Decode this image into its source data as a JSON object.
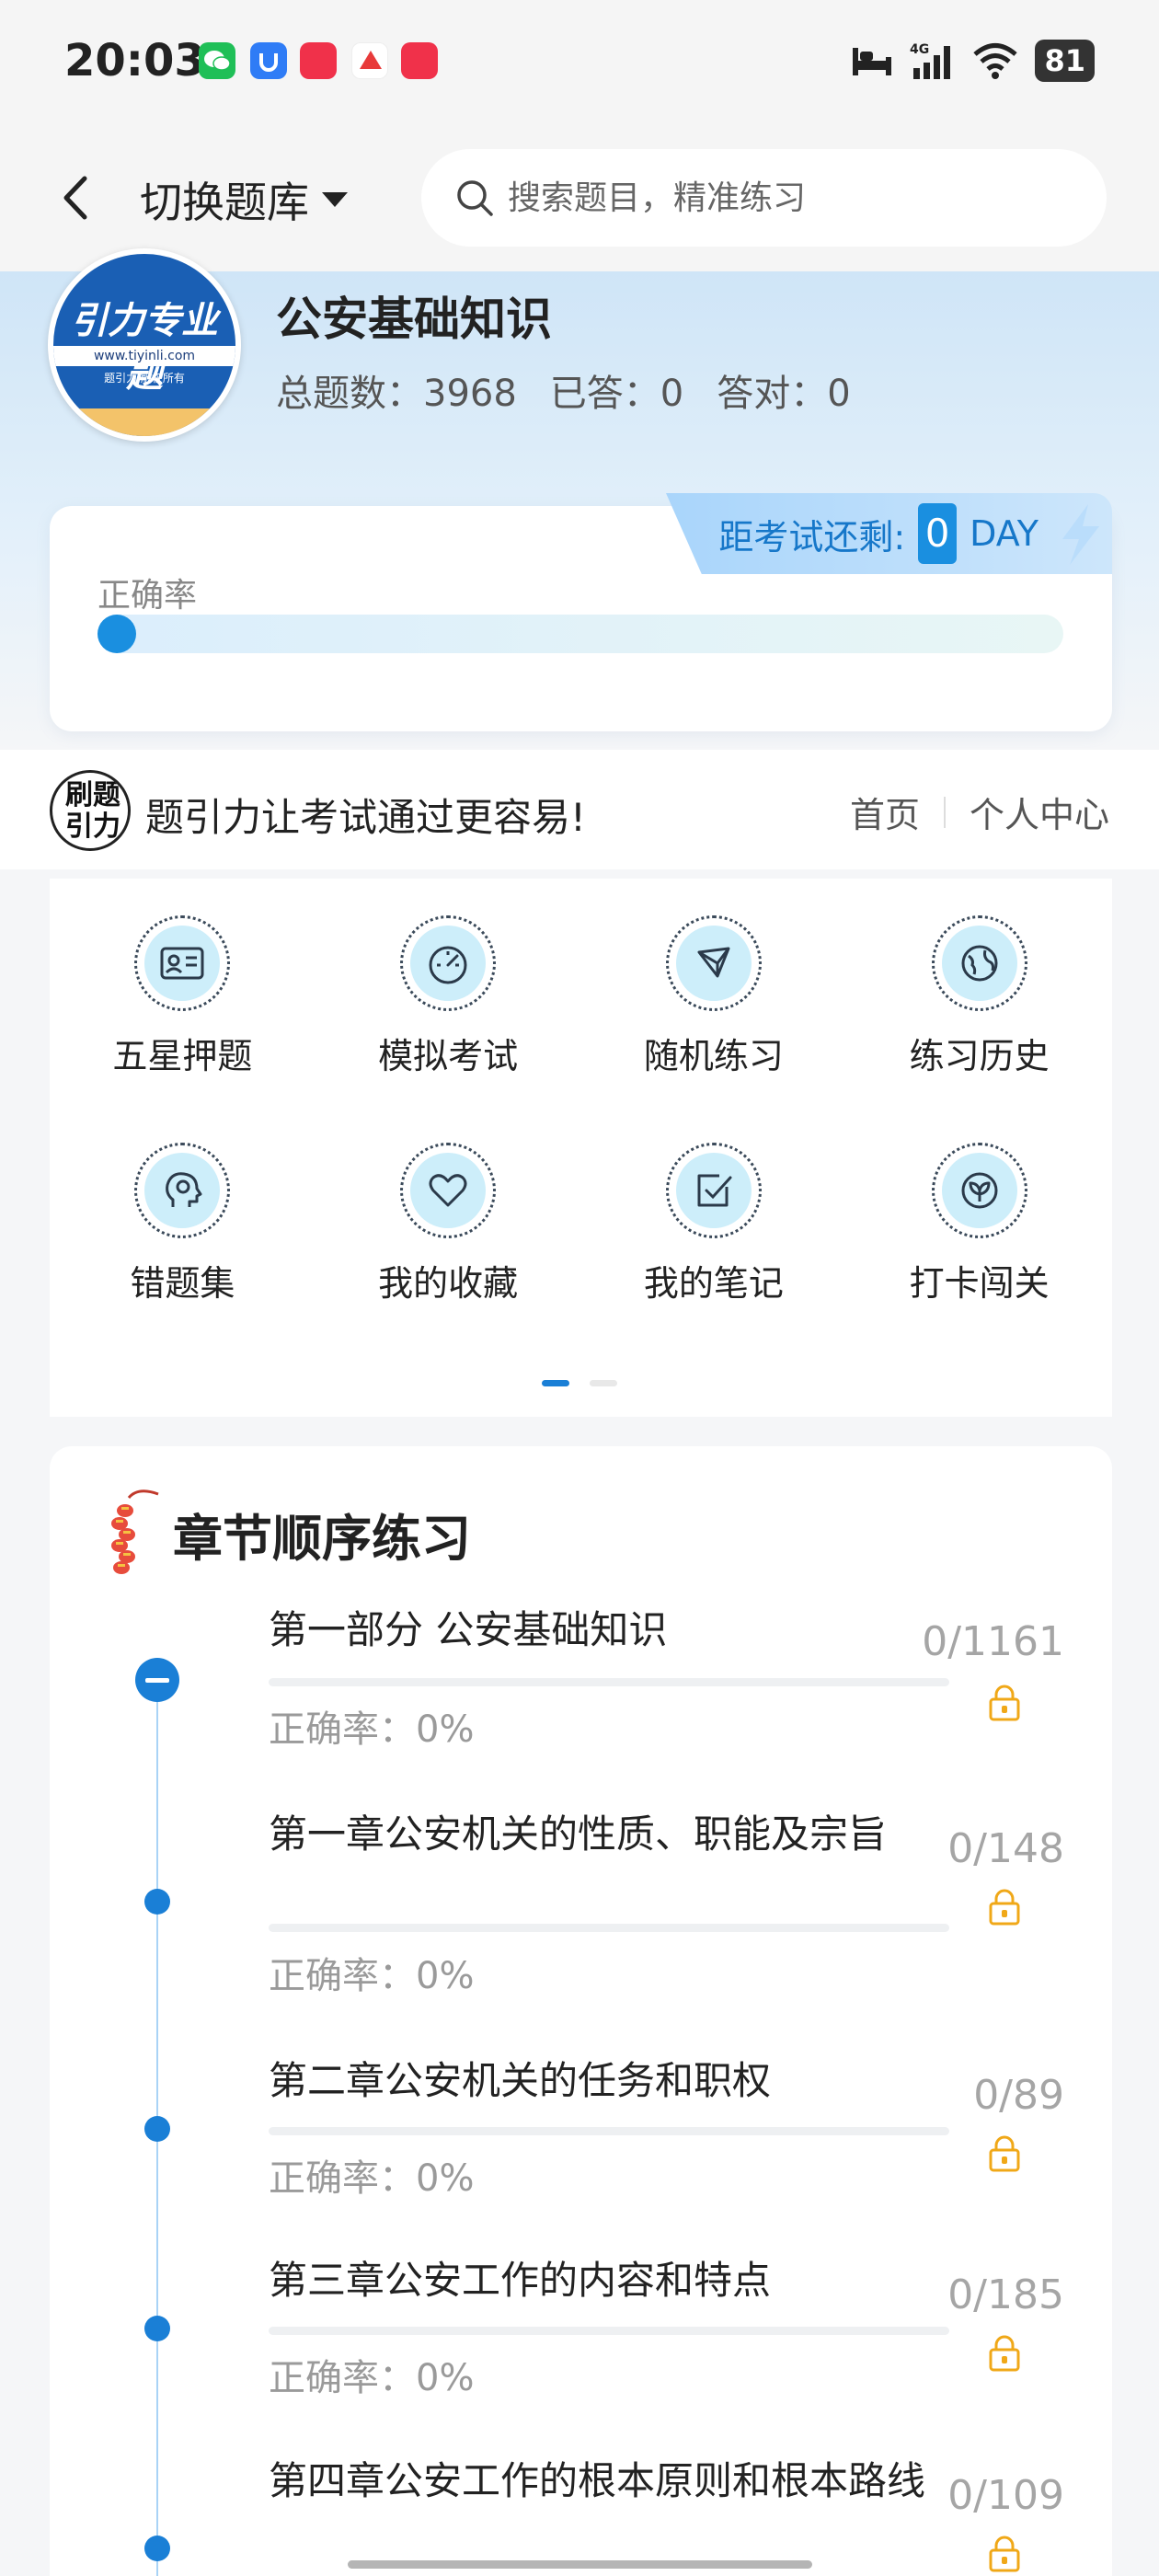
{
  "status_bar": {
    "time": "20:03",
    "battery": "81",
    "network": "4G"
  },
  "nav": {
    "switch_label": "切换题库",
    "search_placeholder": "搜索题目，精准练习"
  },
  "bank": {
    "logo_brand": "引力专业题",
    "logo_site": "www.tiyinli.com",
    "logo_copy": "题引力 版权所有",
    "title": "公安基础知识",
    "total_label": "总题数：3968",
    "answered_label": "已答：0",
    "correct_label": "答对：0"
  },
  "accuracy": {
    "countdown_label": "距考试还剩:",
    "countdown_days": "0",
    "countdown_unit": "DAY",
    "label": "正确率",
    "value_fraction": 0
  },
  "banner": {
    "logo_text": "刷题引力",
    "slogan": "题引力让考试通过更容易!",
    "home": "首页",
    "profile": "个人中心"
  },
  "menu": {
    "items": [
      {
        "label": "五星押题",
        "icon": "id-card-icon"
      },
      {
        "label": "模拟考试",
        "icon": "gauge-icon"
      },
      {
        "label": "随机练习",
        "icon": "shuffle-icon"
      },
      {
        "label": "练习历史",
        "icon": "globe-icon"
      },
      {
        "label": "错题集",
        "icon": "head-icon"
      },
      {
        "label": "我的收藏",
        "icon": "heart-icon"
      },
      {
        "label": "我的笔记",
        "icon": "note-check-icon"
      },
      {
        "label": "打卡闯关",
        "icon": "leaf-icon"
      }
    ],
    "page": 1,
    "pages": 2
  },
  "chapters": {
    "title": "章节顺序练习",
    "items": [
      {
        "name": "第一部分 公安基础知识",
        "rate": "正确率：0%",
        "count": "0/1161"
      },
      {
        "name": "第一章公安机关的性质、职能及宗旨",
        "rate": "正确率：0%",
        "count": "0/148"
      },
      {
        "name": "第二章公安机关的任务和职权",
        "rate": "正确率：0%",
        "count": "0/89"
      },
      {
        "name": "第三章公安工作的内容和特点",
        "rate": "正确率：0%",
        "count": "0/185"
      },
      {
        "name": "第四章公安工作的根本原则和根本路线",
        "rate": "",
        "count": "0/109"
      }
    ]
  },
  "colors": {
    "accent": "#1a7fd6",
    "lock": "#f0a818",
    "text_muted": "#9a9a9a"
  }
}
